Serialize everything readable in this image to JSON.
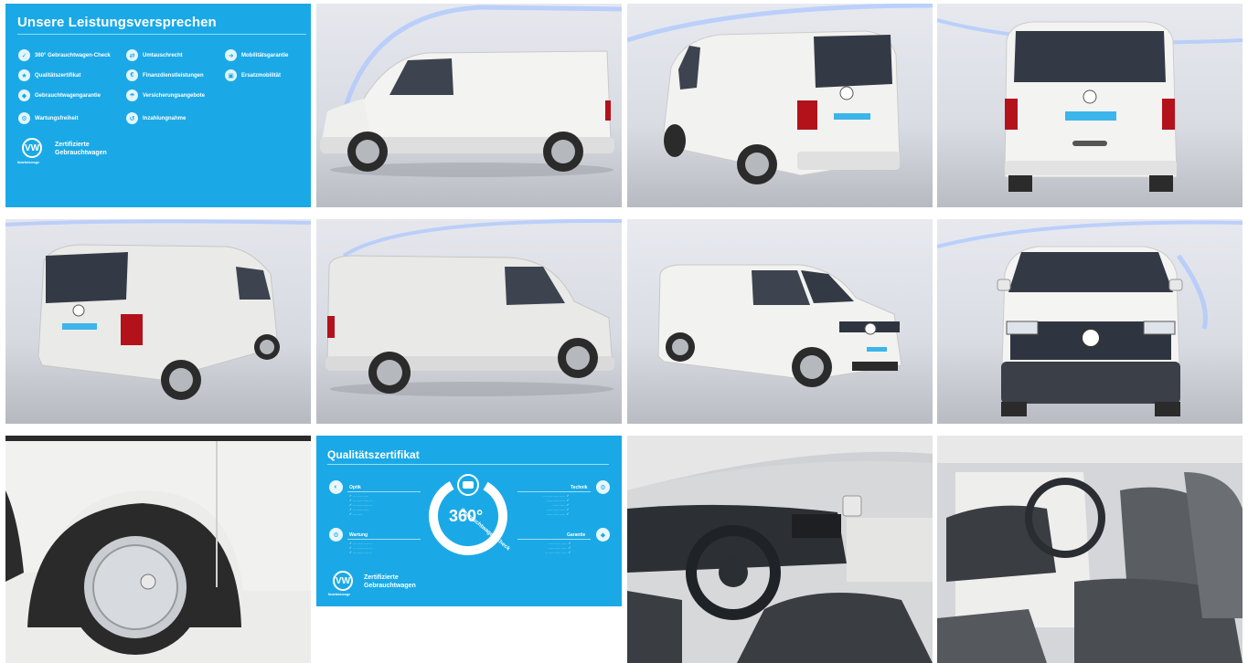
{
  "gallery": {
    "panel_promises": {
      "title": "Unsere Leistungsversprechen",
      "items": [
        {
          "label": "360° Gebrauchtwagen-Check",
          "icon": "check-360-icon"
        },
        {
          "label": "Qualitätszertifikat",
          "icon": "certificate-icon"
        },
        {
          "label": "Gebrauchtwagengarantie",
          "icon": "warranty-icon"
        },
        {
          "label": "Wartungsfreiheit",
          "icon": "maintenance-icon"
        },
        {
          "label": "Umtauschrecht",
          "icon": "exchange-icon"
        },
        {
          "label": "Finanzdienstleistungen",
          "icon": "finance-icon"
        },
        {
          "label": "Versicherungsangebote",
          "icon": "insurance-icon"
        },
        {
          "label": "Inzahlungnahme",
          "icon": "trade-in-icon"
        },
        {
          "label": "Mobilitätsgarantie",
          "icon": "mobility-icon"
        },
        {
          "label": "Ersatzmobilität",
          "icon": "replacement-car-icon"
        }
      ],
      "brand_line1": "Zertifizierte",
      "brand_line2": "Gebrauchtwagen",
      "brand_small": "Nutzfahrzeuge",
      "logo_letters": "VW"
    },
    "panel_certificate": {
      "title": "Qualitätszertifikat",
      "ring_number": "360°",
      "ring_caption": "Gebrauchtwagen-Check",
      "sections": {
        "optik": "Optik",
        "wartung": "Wartung",
        "technik": "Technik",
        "garantie": "Garantie"
      },
      "brand_line1": "Zertifizierte",
      "brand_line2": "Gebrauchtwagen",
      "brand_small": "Nutzfahrzeuge",
      "logo_letters": "VW"
    },
    "colors": {
      "accent_blue": "#1aa9e6",
      "studio_bg": "#d9dce3",
      "van_white": "#f1f1ef",
      "glow": "#8fb4ff"
    }
  }
}
